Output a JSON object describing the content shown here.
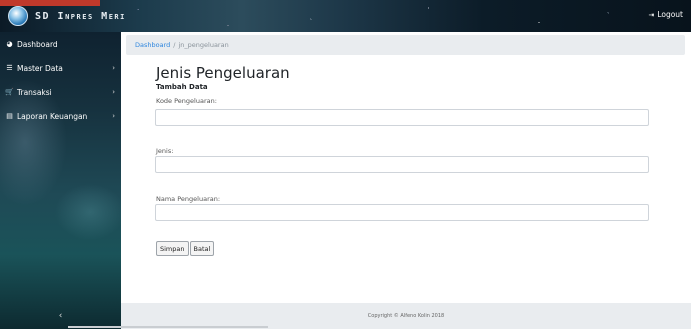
{
  "header": {
    "brand_title": "SD Inpres Meri",
    "logout_label": "Logout",
    "logout_icon": "sign-out-icon"
  },
  "sidebar": {
    "items": [
      {
        "label": "Dashboard",
        "icon": "dashboard-icon",
        "has_submenu": false
      },
      {
        "label": "Master Data",
        "icon": "list-icon",
        "has_submenu": true
      },
      {
        "label": "Transaksi",
        "icon": "cart-icon",
        "has_submenu": true
      },
      {
        "label": "Laporan Keuangan",
        "icon": "report-icon",
        "has_submenu": true
      }
    ],
    "toggle_icon": "chevron-left-icon"
  },
  "breadcrumb": {
    "home": "Dashboard",
    "separator": "/",
    "current": "jn_pengeluaran"
  },
  "main": {
    "title": "Jenis Pengeluaran",
    "subtitle": "Tambah Data",
    "fields": [
      {
        "label": "Kode Pengeluaran:",
        "value": "",
        "placeholder": ""
      },
      {
        "label": "Jenis:",
        "value": "",
        "placeholder": ""
      },
      {
        "label": "Nama Pengeluaran:",
        "value": "",
        "placeholder": ""
      }
    ],
    "buttons": {
      "save": "Simpan",
      "cancel": "Batal"
    }
  },
  "footer": {
    "copyright": "Copyright © Alfeno Kolin 2018"
  },
  "colors": {
    "brand_accent": "#c0392b",
    "link": "#2e86de",
    "breadcrumb_bg": "#e9ecef"
  }
}
